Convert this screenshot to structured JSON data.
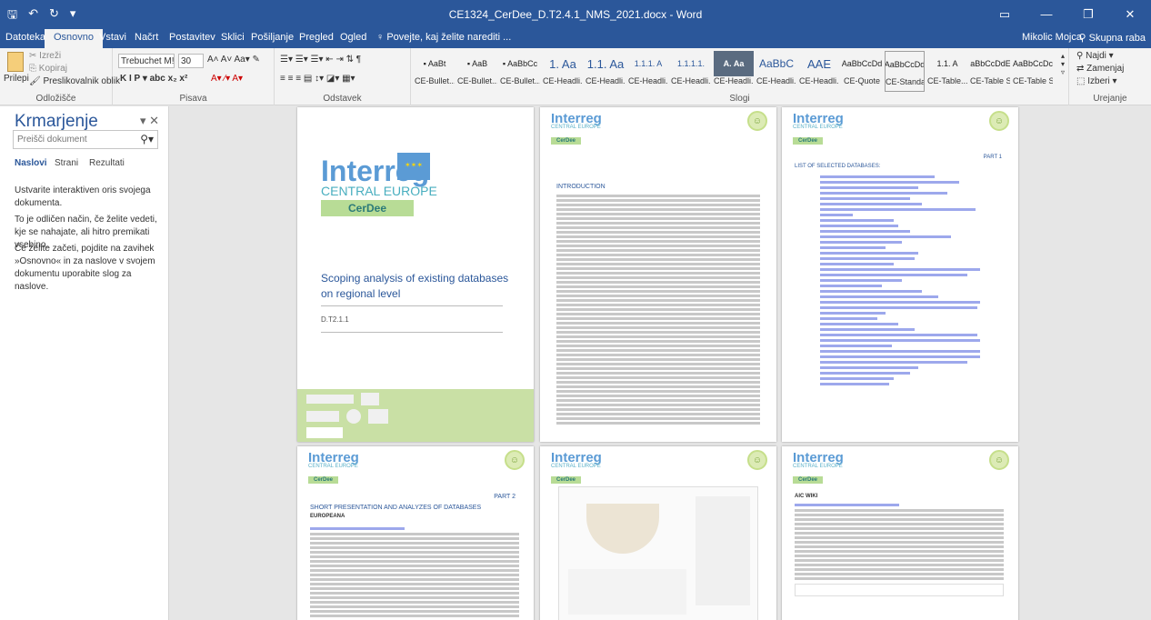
{
  "title": "CE1324_CerDee_D.T2.4.1_NMS_2021.docx - Word",
  "user": "Mikolic Mojca",
  "share": "Skupna raba",
  "tabs": [
    "Datoteka",
    "Osnovno",
    "Vstavi",
    "Načrt",
    "Postavitev",
    "Sklici",
    "Pošiljanje",
    "Pregled",
    "Ogled"
  ],
  "tell_me": "Povejte, kaj želite narediti ...",
  "ribbon": {
    "paste": "Prilepi",
    "cut": "Izreži",
    "copy": "Kopiraj",
    "format_painter": "Preslikovalnik oblik",
    "clipboard": "Odložišče",
    "font": "Trebuchet M!",
    "size": "30",
    "font_group": "Pisava",
    "paragraph_group": "Odstavek",
    "styles_group": "Slogi",
    "editing_group": "Urejanje",
    "find": "Najdi",
    "replace": "Zamenjaj",
    "select": "Izberi",
    "styles": [
      {
        "preview": "▪ AaBt",
        "name": "CE-Bullet..."
      },
      {
        "preview": "▪ AaB",
        "name": "CE-Bullet..."
      },
      {
        "preview": "▪ AaBbCc",
        "name": "CE-Bullet..."
      },
      {
        "preview": "1. Aa",
        "name": "CE-Headli..."
      },
      {
        "preview": "1.1. Aa",
        "name": "CE-Headli..."
      },
      {
        "preview": "1.1.1. A",
        "name": "CE-Headli..."
      },
      {
        "preview": "1.1.1.1.",
        "name": "CE-Headli..."
      },
      {
        "preview": "A. Aa",
        "name": "CE-Headli..."
      },
      {
        "preview": "AaBbC",
        "name": "CE-Headli..."
      },
      {
        "preview": "AAE",
        "name": "CE-Headli..."
      },
      {
        "preview": "AaBbCcDd",
        "name": "CE-Quote"
      },
      {
        "preview": "AaBbCcDd",
        "name": "CE-Standa..."
      },
      {
        "preview": "1.1. A",
        "name": "CE-Table..."
      },
      {
        "preview": "AaBbCcDdEe",
        "name": "CE-Table S..."
      },
      {
        "preview": "AaBbCcDc",
        "name": "CE-Table S..."
      }
    ]
  },
  "nav": {
    "title": "Krmarjenje",
    "search_placeholder": "Preišči dokument",
    "tabs": [
      "Naslovi",
      "Strani",
      "Rezultati"
    ],
    "p1": "Ustvarite interaktiven oris svojega dokumenta.",
    "p2": "To je odličen način, če želite vedeti, kje se nahajate, ali hitro premikati vsebino.",
    "p3": "Če želite začeti, pojdite na zavihek »Osnovno« in za naslove v svojem dokumentu uporabite slog za naslove."
  },
  "pages": {
    "logo": "Interreg",
    "logo_sub": "CENTRAL EUROPE",
    "logo_proj": "CerDee",
    "cover_title": "Scoping analysis of existing databases on regional level",
    "cover_code": "D.T2.1.1",
    "intro_head": "INTRODUCTION",
    "part1": "PART 1",
    "list_head": "LIST OF SELECTED DATABASES:",
    "part2": "PART 2",
    "short_head": "SHORT PRESENTATION AND ANALYZES OF DATABASES",
    "europeana": "EUROPEANA",
    "aic": "AIC WIKI"
  }
}
